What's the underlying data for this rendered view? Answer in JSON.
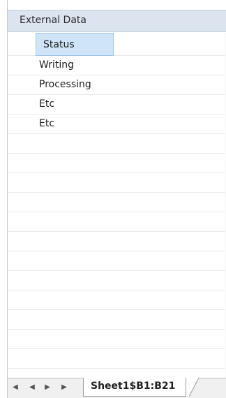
{
  "panel": {
    "title": "External Data"
  },
  "table": {
    "column_header": "Status",
    "rows": [
      "Writing",
      "Processing",
      "Etc",
      "Etc"
    ]
  },
  "sheet_tabs": {
    "active_tab": "Sheet1$B1:B21",
    "nav_icons": [
      "first-sheet-icon",
      "prev-sheet-icon",
      "next-sheet-icon",
      "last-sheet-icon"
    ]
  },
  "colors": {
    "title_bar": "#dce4ef",
    "header_cell": "#cfe5f7",
    "gridline": "#e9e9e9"
  }
}
